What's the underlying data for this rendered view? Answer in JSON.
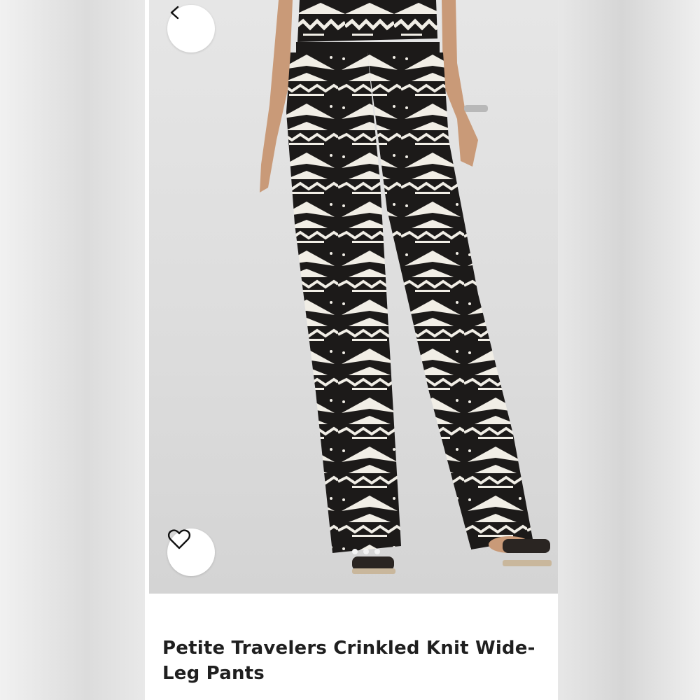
{
  "product": {
    "title": "Petite Travelers  Crinkled Knit Wide-Leg Pants"
  },
  "image": {
    "carousel_dots": 3,
    "active_dot": 0
  },
  "icons": {
    "back": "chevron-left-icon",
    "favorite": "heart-outline-icon"
  },
  "colors": {
    "background": "#ffffff",
    "photo_backdrop": "#dcdcdc",
    "pants_dark": "#1c1a19",
    "pants_light": "#f1eee6",
    "title_text": "#1f1f1f"
  }
}
